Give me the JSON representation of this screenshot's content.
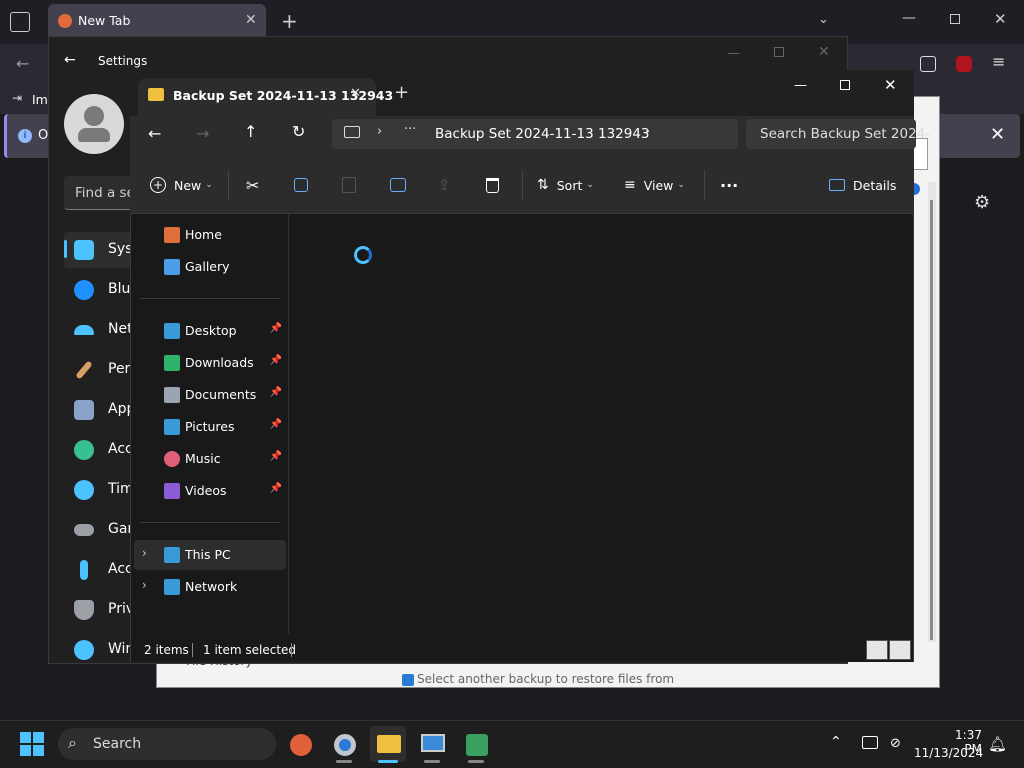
{
  "firefox": {
    "tab_title": "New Tab",
    "bookmark_partial": "Imp",
    "infobar_partial": "O"
  },
  "backup_window": {
    "item_partial": "File History",
    "select_text": "Select another backup to restore files from"
  },
  "settings": {
    "title": "Settings",
    "search_placeholder": "Find a se",
    "nav": [
      {
        "label": "Syst",
        "icon": "system-icon",
        "color": "#4cc2ff"
      },
      {
        "label": "Blue",
        "icon": "bluetooth-icon",
        "color": "#1e90ff"
      },
      {
        "label": "Net",
        "icon": "network-icon",
        "color": "#4cc2ff"
      },
      {
        "label": "Pers",
        "icon": "brush-icon",
        "color": "#d9a066"
      },
      {
        "label": "App",
        "icon": "apps-icon",
        "color": "#8aa2c8"
      },
      {
        "label": "Acc",
        "icon": "accounts-icon",
        "color": "#37c090"
      },
      {
        "label": "Tim",
        "icon": "time-icon",
        "color": "#4cc2ff"
      },
      {
        "label": "Gar",
        "icon": "gaming-icon",
        "color": "#9aa0a6"
      },
      {
        "label": "Acc",
        "icon": "accessibility-icon",
        "color": "#4cc2ff"
      },
      {
        "label": "Priv",
        "icon": "privacy-icon",
        "color": "#9aa0a6"
      },
      {
        "label": "Win",
        "icon": "update-icon",
        "color": "#4cc2ff"
      }
    ]
  },
  "explorer": {
    "tab_title": "Backup Set 2024-11-13 132943",
    "address": "Backup Set 2024-11-13 132943",
    "search_placeholder": "Search Backup Set 2024-",
    "commands": {
      "new": "New",
      "sort": "Sort",
      "view": "View",
      "details": "Details"
    },
    "nav_top": [
      {
        "label": "Home",
        "icon": "home-icon",
        "color": "#e0703a"
      },
      {
        "label": "Gallery",
        "icon": "gallery-icon",
        "color": "#4a9ee8"
      }
    ],
    "nav_pinned": [
      {
        "label": "Desktop",
        "icon": "desktop-icon",
        "color": "#3a9ad9"
      },
      {
        "label": "Downloads",
        "icon": "downloads-icon",
        "color": "#2fb36c"
      },
      {
        "label": "Documents",
        "icon": "documents-icon",
        "color": "#9aa4b5"
      },
      {
        "label": "Pictures",
        "icon": "pictures-icon",
        "color": "#3a9ad9"
      },
      {
        "label": "Music",
        "icon": "music-icon",
        "color": "#e0607a"
      },
      {
        "label": "Videos",
        "icon": "videos-icon",
        "color": "#8a5cd6"
      }
    ],
    "nav_bottom": [
      {
        "label": "This PC",
        "icon": "this-pc-icon",
        "color": "#3a9ad9"
      },
      {
        "label": "Network",
        "icon": "network-icon",
        "color": "#3a9ad9"
      }
    ],
    "status": {
      "items": "2 items",
      "selected": "1 item selected"
    }
  },
  "taskbar": {
    "search_label": "Search",
    "time": "1:37 PM",
    "date": "11/13/2024",
    "apps": [
      "firefox-icon",
      "settings-icon",
      "file-explorer-icon",
      "control-panel-icon",
      "recycle-tool-icon"
    ]
  }
}
